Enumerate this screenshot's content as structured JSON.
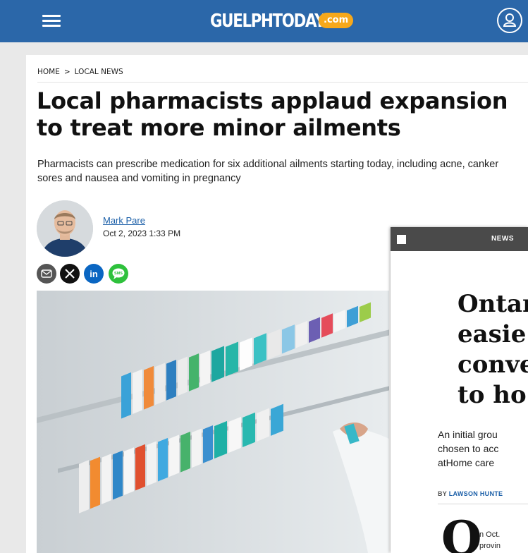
{
  "header": {
    "logo_text": "GUELPHTODAY",
    "logo_badge": ".com",
    "brand_color": "#2b67a9",
    "badge_color": "#f6a81b"
  },
  "breadcrumb": {
    "home": "HOME",
    "separator": ">",
    "section": "LOCAL NEWS"
  },
  "article": {
    "headline": "Local pharmacists applaud expansion to treat more minor ailments",
    "subhead": "Pharmacists can prescribe medication for six additional ailments starting today, including acne, canker sores and nausea and vomiting in pregnancy",
    "author": "Mark Pare",
    "date": "Oct 2, 2023 1:33 PM"
  },
  "share": {
    "email_icon": "email-icon",
    "x_icon": "x-icon",
    "linkedin_label": "in",
    "sms_label": "SMS"
  },
  "ad": {
    "tag": "NEWS",
    "headline": "Ontar\neasie\nconve\nto ho",
    "body": "An initial grou\nchosen to acc\natHome care",
    "byline_prefix": "BY ",
    "byline_name": "LAWSON HUNTE",
    "drop_cap": "O",
    "drop_text": "n Oct.\nprovin"
  }
}
